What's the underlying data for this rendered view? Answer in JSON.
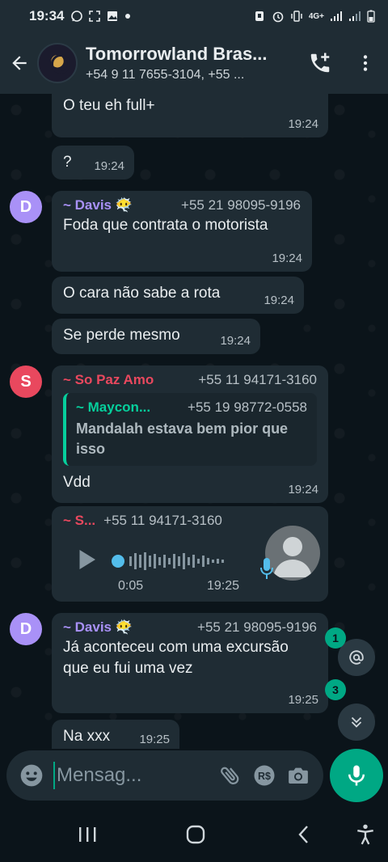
{
  "status_bar": {
    "time": "19:34",
    "left_icons": [
      "whatsapp-icon",
      "screenshot-icon",
      "image-icon",
      "dot-icon"
    ],
    "network": "4G+"
  },
  "header": {
    "title": "Tomorrowland Bras...",
    "subtitle": "+54 9 11 7655-3104, +55 ...",
    "actions": [
      "add-call-icon",
      "more-vert-icon"
    ]
  },
  "messages": [
    {
      "type": "text",
      "text": "O teu eh full+",
      "time": "19:24"
    },
    {
      "type": "text",
      "text": "?",
      "time": "19:24"
    },
    {
      "type": "text",
      "avatar": "D",
      "sender": "~ Davis 😶‍🌫️",
      "phone": "+55 21 98095-9196",
      "text": "Foda que contrata o motorista",
      "time": "19:24"
    },
    {
      "type": "text",
      "text": "O cara não sabe a rota",
      "time": "19:24"
    },
    {
      "type": "text",
      "text": "Se perde mesmo",
      "time": "19:24"
    },
    {
      "type": "reply",
      "avatar": "S",
      "sender": "~ So Paz Amo",
      "phone": "+55 11 94171-3160",
      "quote": {
        "sender": "~ Maycon...",
        "phone": "+55 19 98772-0558",
        "text": "Mandalah estava bem pior que isso"
      },
      "text": "Vdd",
      "time": "19:24"
    },
    {
      "type": "voice",
      "sender": "~ S...",
      "phone": "+55 11 94171-3160",
      "duration": "0:05",
      "time": "19:25"
    },
    {
      "type": "text",
      "avatar": "D",
      "sender": "~ Davis 😶‍🌫️",
      "phone": "+55 21 98095-9196",
      "text": "Já aconteceu com uma excursão que eu fui uma vez",
      "time": "19:25"
    },
    {
      "type": "text",
      "text": "Na xxx",
      "time": "19:25"
    }
  ],
  "badges": {
    "mentions": "1",
    "unread": "3"
  },
  "composer": {
    "placeholder": "Mensag..."
  },
  "colors": {
    "accent": "#00a884",
    "bubble": "#1f2c34",
    "davis": "#a991f7",
    "so_paz": "#e9485e"
  }
}
